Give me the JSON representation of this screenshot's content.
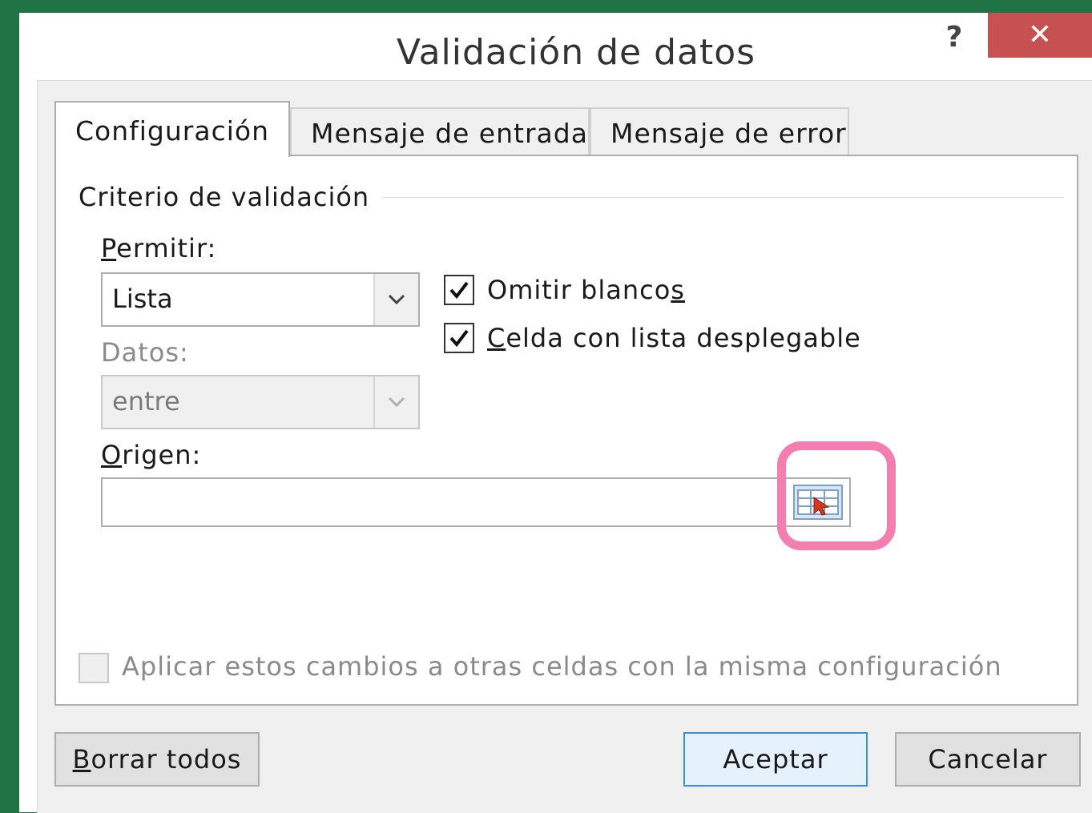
{
  "window": {
    "title": "Validación de datos",
    "help_label": "?",
    "close_label": "✕"
  },
  "tabs": [
    {
      "label": "Configuración",
      "active": true
    },
    {
      "label": "Mensaje de entrada",
      "active": false
    },
    {
      "label": "Mensaje de error",
      "active": false
    }
  ],
  "criteria": {
    "group_title": "Criterio de validación",
    "allow_label_ul": "P",
    "allow_label_rest": "ermitir:",
    "allow_value": "Lista",
    "data_label": "Datos:",
    "data_value": "entre",
    "ignore_blank_pre": "Omitir blanco",
    "ignore_blank_ul": "s",
    "ignore_blank_checked": true,
    "dropdown_ul": "C",
    "dropdown_rest": "elda con lista desplegable",
    "dropdown_checked": true,
    "source_label_ul": "O",
    "source_label_rest": "rigen:",
    "source_value": ""
  },
  "apply_all_label": "Aplicar estos cambios a otras celdas con la misma configuración",
  "buttons": {
    "clear_ul": "B",
    "clear_rest": "orrar todos",
    "ok": "Aceptar",
    "cancel": "Cancelar"
  },
  "colors": {
    "excel_green": "#217346",
    "close_red": "#c75050",
    "highlight_pink": "#f27fb0"
  }
}
